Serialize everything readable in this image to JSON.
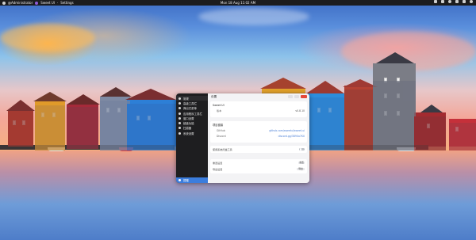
{
  "topbar": {
    "user": "@Administrator",
    "app_name": "Sweet UI",
    "separator": "·",
    "window_label": "Settings",
    "clock": "Mon 18 Aug  11:02 AM"
  },
  "window": {
    "title": "设置"
  },
  "sidebar": {
    "items": [
      {
        "label": "常规",
        "active": true
      },
      {
        "label": "高级工具栏",
        "active": false
      },
      {
        "label": "弹出式菜单",
        "active": false
      },
      {
        "label": "应用程序工具栏",
        "active": false
      },
      {
        "label": "窗口设置",
        "active": false
      },
      {
        "label": "超级功能",
        "active": false
      },
      {
        "label": "扫描器",
        "active": false
      },
      {
        "label": "系统设置",
        "active": false
      }
    ],
    "footer_label": "捐赠"
  },
  "about": {
    "name": "Sweet UI",
    "version_label": "版本",
    "version": "v0.8.10"
  },
  "links": {
    "heading": "项目链接",
    "github_label": "GitHub",
    "github_url": "github.com/sweetui/sweet-ui",
    "discord_label": "Discord",
    "discord_url": "discord.gg/3B9Xa7KX"
  },
  "options": {
    "tray_label": "使用系统托盘工具",
    "tray_enabled": false,
    "reset_label": "重置设置",
    "reset_button": "重置",
    "export_label": "导出设置",
    "export_button": "导出"
  }
}
